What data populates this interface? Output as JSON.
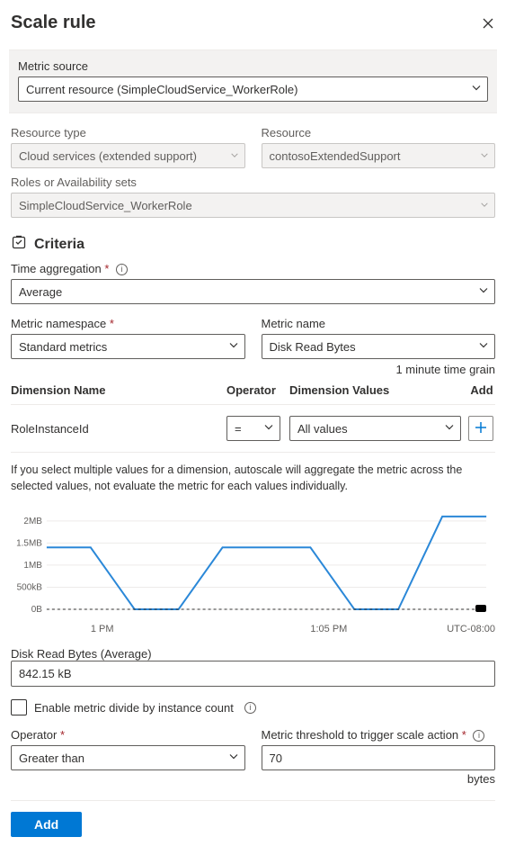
{
  "header": {
    "title": "Scale rule"
  },
  "metric_source": {
    "label": "Metric source",
    "value": "Current resource (SimpleCloudService_WorkerRole)"
  },
  "resource_type": {
    "label": "Resource type",
    "value": "Cloud services (extended support)"
  },
  "resource": {
    "label": "Resource",
    "value": "contosoExtendedSupport"
  },
  "roles": {
    "label": "Roles or Availability sets",
    "value": "SimpleCloudService_WorkerRole"
  },
  "criteria": {
    "heading": "Criteria"
  },
  "time_aggregation": {
    "label": "Time aggregation",
    "value": "Average"
  },
  "metric_namespace": {
    "label": "Metric namespace",
    "value": "Standard metrics"
  },
  "metric_name": {
    "label": "Metric name",
    "value": "Disk Read Bytes"
  },
  "time_grain": "1 minute time grain",
  "dim_table": {
    "headers": {
      "name": "Dimension Name",
      "operator": "Operator",
      "values": "Dimension Values",
      "add": "Add"
    },
    "row": {
      "name": "RoleInstanceId",
      "operator": "=",
      "values": "All values"
    }
  },
  "dim_hint": "If you select multiple values for a dimension, autoscale will aggregate the metric across the selected values, not evaluate the metric for each values individually.",
  "chart_data": {
    "type": "line",
    "title": "",
    "xlabel": "",
    "ylabel": "",
    "y_ticks": [
      "0B",
      "500kB",
      "1MB",
      "1.5MB",
      "2MB"
    ],
    "ylim_bytes": [
      0,
      2200000
    ],
    "x_ticks": [
      "1 PM",
      "1:05 PM"
    ],
    "tz": "UTC-08:00",
    "series": [
      {
        "name": "Disk Read Bytes (Average)",
        "color": "#2b88d8",
        "x_minutes": [
          0.0,
          1.0,
          2.0,
          3.0,
          4.0,
          5.0,
          6.0,
          7.0,
          8.0,
          9.0,
          10.0
        ],
        "values_bytes": [
          1400000,
          1400000,
          0,
          0,
          1400000,
          1400000,
          1400000,
          0,
          0,
          2100000,
          2100000
        ]
      }
    ]
  },
  "metric_readout": {
    "label": "Disk Read Bytes (Average)",
    "value": "842.15 kB"
  },
  "divide_cb": {
    "label": "Enable metric divide by instance count"
  },
  "operator": {
    "label": "Operator",
    "value": "Greater than"
  },
  "threshold": {
    "label": "Metric threshold to trigger scale action",
    "value": "70",
    "unit": "bytes"
  },
  "footer": {
    "add": "Add"
  }
}
